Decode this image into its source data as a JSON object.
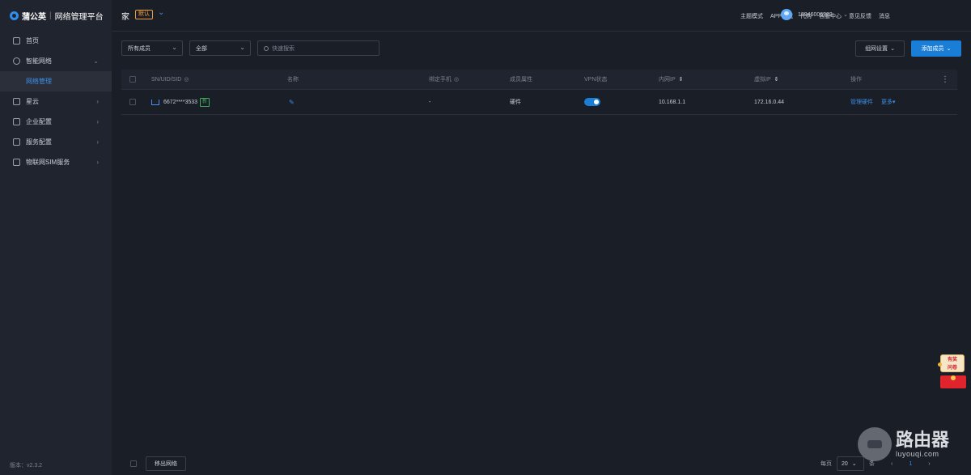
{
  "brand": {
    "name": "蒲公英",
    "separator": "|",
    "subtitle": "网络管理平台"
  },
  "sidebar": {
    "items": [
      {
        "label": "首页",
        "icon": "home-icon"
      },
      {
        "label": "智能网络",
        "icon": "network-icon",
        "arrow": "⌄"
      },
      {
        "label": "网络管理",
        "sub": true
      },
      {
        "label": "星云",
        "icon": "cloud-icon",
        "arrow": "›"
      },
      {
        "label": "企业配置",
        "icon": "enterprise-icon",
        "arrow": "›"
      },
      {
        "label": "服务配置",
        "icon": "service-icon",
        "arrow": "›"
      },
      {
        "label": "物联网SIM服务",
        "icon": "sim-icon",
        "arrow": "›"
      }
    ],
    "version": "版本：v2.3.2"
  },
  "header": {
    "network_name": "家",
    "default_badge": "默认",
    "links": [
      "主题模式",
      "APP下载",
      "代购",
      "客服中心",
      "意见反馈",
      "消息"
    ],
    "phone": "18946006383",
    "phone_chevron": "⌄"
  },
  "filters": {
    "member_type": "所有成员",
    "status": "全部",
    "search_placeholder": "快速搜索"
  },
  "actions": {
    "group_settings": "组网设置",
    "add_member": "添加成员"
  },
  "table": {
    "columns": {
      "sn": "SN/UID/SID",
      "name": "名称",
      "phone": "绑定手机",
      "attr": "成员属性",
      "vpn": "VPN状态",
      "lan_ip": "内网IP",
      "virtual_ip": "虚拟IP",
      "ops": "操作"
    },
    "rows": [
      {
        "sn": "6672****3533",
        "badge": "新",
        "name": "",
        "phone": "-",
        "attr": "硬件",
        "vpn_on": true,
        "lan_ip": "10.168.1.1",
        "virtual_ip": "172.16.0.44",
        "manage": "管理硬件",
        "more": "更多▾"
      }
    ]
  },
  "footer": {
    "move_out": "移出网络",
    "per_page_label": "每页",
    "per_page": "20",
    "unit": "条",
    "prev": "‹",
    "current_page": "1",
    "next": "›"
  },
  "promo": {
    "line1": "有奖",
    "line2": "问卷"
  },
  "watermark": {
    "main": "路由器",
    "sub": "luyouqi.com"
  },
  "colors": {
    "accent": "#1b7ed6",
    "link": "#3d8fe8",
    "badge_orange": "#f59d3a",
    "badge_green": "#3cab5a",
    "bg": "#1a1e27",
    "sidebar_bg": "#20242e"
  }
}
